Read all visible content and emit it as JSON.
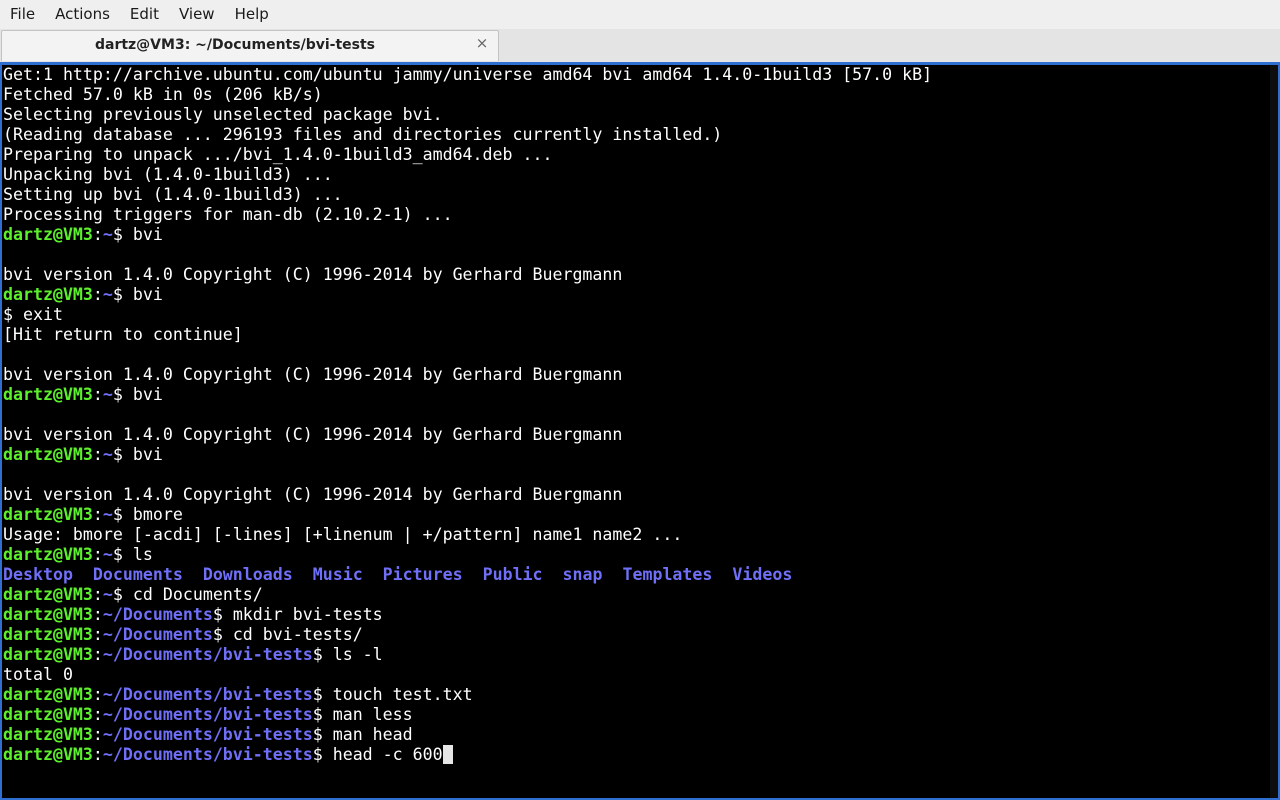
{
  "menu": [
    "File",
    "Actions",
    "Edit",
    "View",
    "Help"
  ],
  "tab": {
    "title": "dartz@VM3: ~/Documents/bvi-tests",
    "close": "×"
  },
  "terminal": {
    "lines": [
      {
        "type": "out",
        "text": "Get:1 http://archive.ubuntu.com/ubuntu jammy/universe amd64 bvi amd64 1.4.0-1build3 [57.0 kB]"
      },
      {
        "type": "out",
        "text": "Fetched 57.0 kB in 0s (206 kB/s)"
      },
      {
        "type": "out",
        "text": "Selecting previously unselected package bvi."
      },
      {
        "type": "out",
        "text": "(Reading database ... 296193 files and directories currently installed.)"
      },
      {
        "type": "out",
        "text": "Preparing to unpack .../bvi_1.4.0-1build3_amd64.deb ..."
      },
      {
        "type": "out",
        "text": "Unpacking bvi (1.4.0-1build3) ..."
      },
      {
        "type": "out",
        "text": "Setting up bvi (1.4.0-1build3) ..."
      },
      {
        "type": "out",
        "text": "Processing triggers for man-db (2.10.2-1) ..."
      },
      {
        "type": "prompt",
        "user": "dartz@VM3",
        "path": "~",
        "cmd": " bvi"
      },
      {
        "type": "out",
        "text": ""
      },
      {
        "type": "out",
        "text": "bvi version 1.4.0 Copyright (C) 1996-2014 by Gerhard Buergmann"
      },
      {
        "type": "prompt",
        "user": "dartz@VM3",
        "path": "~",
        "cmd": " bvi"
      },
      {
        "type": "out",
        "text": "$ exit"
      },
      {
        "type": "out",
        "text": "[Hit return to continue]"
      },
      {
        "type": "out",
        "text": ""
      },
      {
        "type": "out",
        "text": "bvi version 1.4.0 Copyright (C) 1996-2014 by Gerhard Buergmann"
      },
      {
        "type": "prompt",
        "user": "dartz@VM3",
        "path": "~",
        "cmd": " bvi"
      },
      {
        "type": "out",
        "text": ""
      },
      {
        "type": "out",
        "text": "bvi version 1.4.0 Copyright (C) 1996-2014 by Gerhard Buergmann"
      },
      {
        "type": "prompt",
        "user": "dartz@VM3",
        "path": "~",
        "cmd": " bvi"
      },
      {
        "type": "out",
        "text": ""
      },
      {
        "type": "out",
        "text": "bvi version 1.4.0 Copyright (C) 1996-2014 by Gerhard Buergmann"
      },
      {
        "type": "prompt",
        "user": "dartz@VM3",
        "path": "~",
        "cmd": " bmore"
      },
      {
        "type": "out",
        "text": "Usage: bmore [-acdi] [-lines] [+linenum | +/pattern] name1 name2 ..."
      },
      {
        "type": "prompt",
        "user": "dartz@VM3",
        "path": "~",
        "cmd": " ls"
      },
      {
        "type": "dirs",
        "items": [
          "Desktop",
          "Documents",
          "Downloads",
          "Music",
          "Pictures",
          "Public",
          "snap",
          "Templates",
          "Videos"
        ]
      },
      {
        "type": "prompt",
        "user": "dartz@VM3",
        "path": "~",
        "cmd": " cd Documents/"
      },
      {
        "type": "prompt",
        "user": "dartz@VM3",
        "path": "~/Documents",
        "cmd": " mkdir bvi-tests"
      },
      {
        "type": "prompt",
        "user": "dartz@VM3",
        "path": "~/Documents",
        "cmd": " cd bvi-tests/"
      },
      {
        "type": "prompt",
        "user": "dartz@VM3",
        "path": "~/Documents/bvi-tests",
        "cmd": " ls -l"
      },
      {
        "type": "out",
        "text": "total 0"
      },
      {
        "type": "prompt",
        "user": "dartz@VM3",
        "path": "~/Documents/bvi-tests",
        "cmd": " touch test.txt"
      },
      {
        "type": "prompt",
        "user": "dartz@VM3",
        "path": "~/Documents/bvi-tests",
        "cmd": " man less"
      },
      {
        "type": "prompt",
        "user": "dartz@VM3",
        "path": "~/Documents/bvi-tests",
        "cmd": " man head"
      },
      {
        "type": "prompt",
        "user": "dartz@VM3",
        "path": "~/Documents/bvi-tests",
        "cmd": " head -c 600",
        "cursor": true
      }
    ]
  },
  "colors": {
    "prompt_user": "#5cf12c",
    "prompt_path": "#6f6ff8",
    "background": "#000000",
    "text": "#ffffff",
    "focus_border": "#2f6fd1"
  }
}
